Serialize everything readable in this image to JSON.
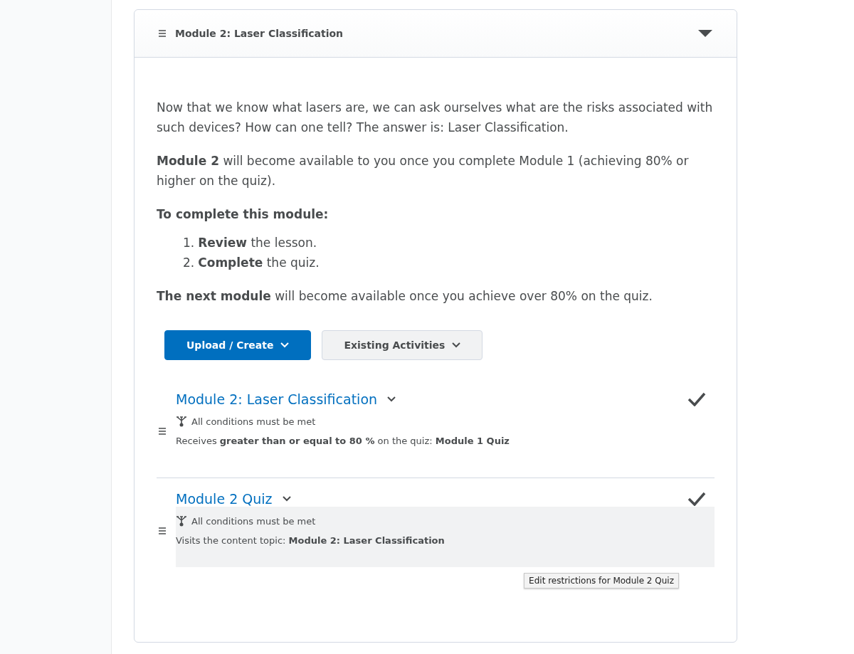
{
  "module": {
    "title": "Module 2: Laser Classification",
    "expanded": true
  },
  "description": [
    "Now that we know what lasers are, we can ask ourselves what are the risks associated with such devices? How can one tell? The answer is: Laser Classification.",
    "**Module 2** will become available to you once you complete Module 1 (achieving 80% or higher on the quiz).",
    "**To complete this module:**"
  ],
  "steps": [
    {
      "marker": "1.",
      "text": "**Review** the lesson."
    },
    {
      "marker": "2.",
      "text": "**Complete** the quiz."
    }
  ],
  "closing": "**The next module** will become available once you achieve over 80% on the quiz.",
  "buttons": [
    {
      "label": "Upload / Create",
      "kind": "primary"
    },
    {
      "label": "Existing Activities",
      "kind": "secondary"
    }
  ],
  "items": [
    {
      "title": "Module 2: Laser Classification",
      "completed": true,
      "hovered": false,
      "condition_heading": "All conditions must be met",
      "condition": "Receives **greater than or equal to 80 %** on the quiz: **Module 1 Quiz**"
    },
    {
      "title": "Module 2 Quiz",
      "completed": true,
      "hovered": true,
      "condition_heading": "All conditions must be met",
      "condition": "Visits the content topic: **Module 2: Laser Classification**",
      "tooltip": "Edit restrictions for Module 2 Quiz"
    }
  ]
}
